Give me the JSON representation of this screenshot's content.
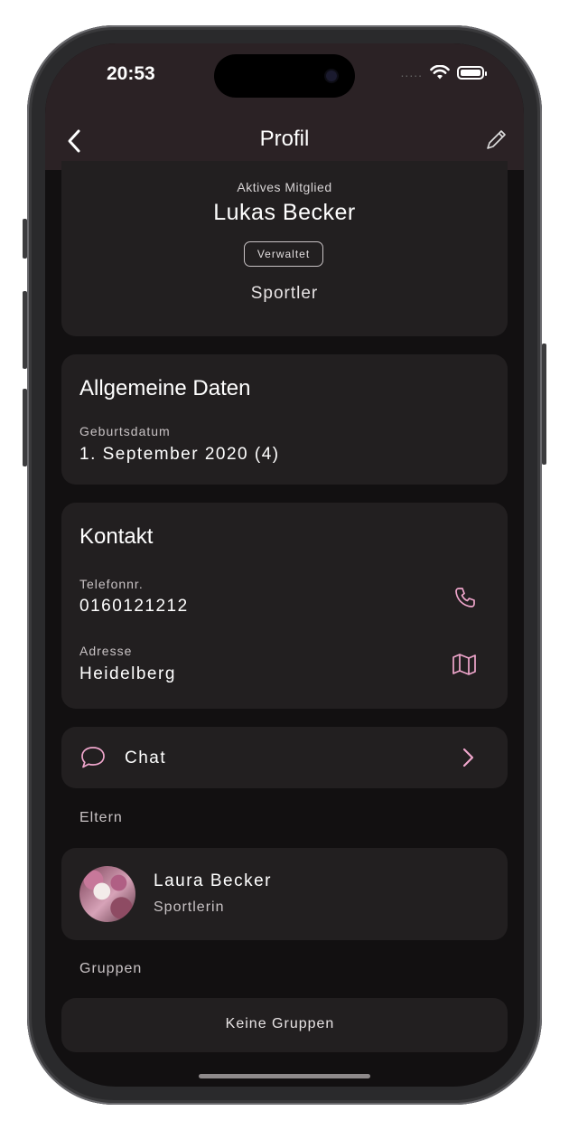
{
  "status_bar": {
    "time": "20:53",
    "signal_dots": "....."
  },
  "nav": {
    "title": "Profil"
  },
  "profile": {
    "status": "Aktives Mitglied",
    "first_name": "Lukas",
    "last_name": "Becker",
    "badge": "Verwaltet",
    "role": "Sportler"
  },
  "general": {
    "title": "Allgemeine Daten",
    "birthdate_label": "Geburtsdatum",
    "birthdate_value": "1. September 2020 (4)"
  },
  "contact": {
    "title": "Kontakt",
    "phone_label": "Telefonnr.",
    "phone_value": "0160121212",
    "address_label": "Adresse",
    "address_value": "Heidelberg"
  },
  "chat": {
    "label": "Chat"
  },
  "parents": {
    "caption": "Eltern",
    "items": [
      {
        "name": "Laura Becker",
        "role": "Sportlerin"
      }
    ]
  },
  "groups": {
    "caption": "Gruppen",
    "empty_label": "Keine Gruppen"
  },
  "colors": {
    "accent": "#f0a6cc",
    "card": "#221f20",
    "header": "#2b2225",
    "background": "#121011"
  }
}
